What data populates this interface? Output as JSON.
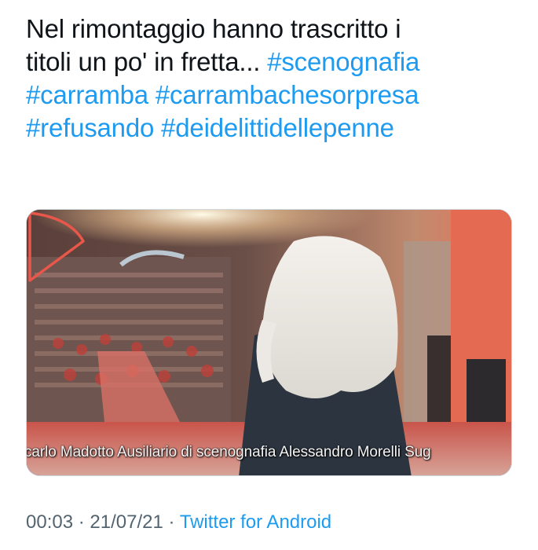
{
  "tweet": {
    "line1": "Nel rimontaggio hanno trascritto i",
    "line2_text": "titoli un po' in fretta... ",
    "hashtags": [
      "#scenognafia",
      "#carramba",
      "#carrambachesorpresa",
      "#refusando",
      "#deidelittidellepenne"
    ]
  },
  "media": {
    "caption": "carlo Madotto Ausiliario di scenognafia Alessandro Morelli Sug",
    "play_icon": "play-triangle-icon",
    "play_color": "#e8574a"
  },
  "meta": {
    "time": "00:03",
    "separator": "·",
    "date": "21/07/21",
    "source": "Twitter for Android"
  },
  "colors": {
    "text": "#0f1419",
    "link": "#1d9bf0",
    "secondary": "#536471"
  }
}
